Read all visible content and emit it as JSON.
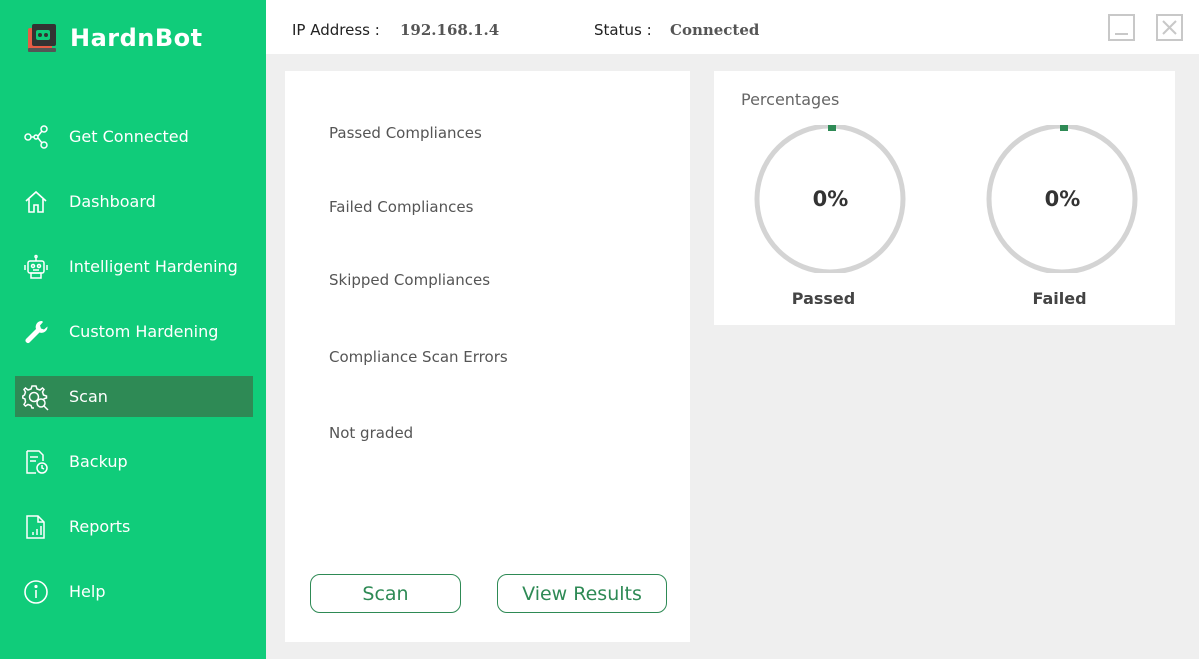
{
  "app": {
    "name": "HardnBot"
  },
  "sidebar": {
    "items": [
      {
        "label": "Get Connected",
        "icon": "share-icon",
        "active": false
      },
      {
        "label": "Dashboard",
        "icon": "home-icon",
        "active": false
      },
      {
        "label": "Intelligent Hardening",
        "icon": "robot-icon",
        "active": false
      },
      {
        "label": "Custom Hardening",
        "icon": "wrench-icon",
        "active": false
      },
      {
        "label": "Scan",
        "icon": "scan-gear-icon",
        "active": true
      },
      {
        "label": "Backup",
        "icon": "backup-icon",
        "active": false
      },
      {
        "label": "Reports",
        "icon": "reports-icon",
        "active": false
      },
      {
        "label": "Help",
        "icon": "info-icon",
        "active": false
      }
    ]
  },
  "topbar": {
    "ip_label": "IP Address :",
    "ip_value": "192.168.1.4",
    "status_label": "Status :",
    "status_value": "Connected"
  },
  "compliances": {
    "items": [
      "Passed Compliances",
      "Failed Compliances",
      "Skipped Compliances",
      "Compliance Scan Errors",
      "Not graded"
    ],
    "scan_button": "Scan",
    "view_results_button": "View Results"
  },
  "percentages": {
    "title": "Percentages",
    "passed": {
      "value": "0%",
      "label": "Passed",
      "fraction": 0
    },
    "failed": {
      "value": "0%",
      "label": "Failed",
      "fraction": 0
    }
  },
  "colors": {
    "sidebar": "#10cc7a",
    "active_item": "#2e8a55",
    "accent": "#2e8a55",
    "ring_track": "#d4d4d4"
  }
}
